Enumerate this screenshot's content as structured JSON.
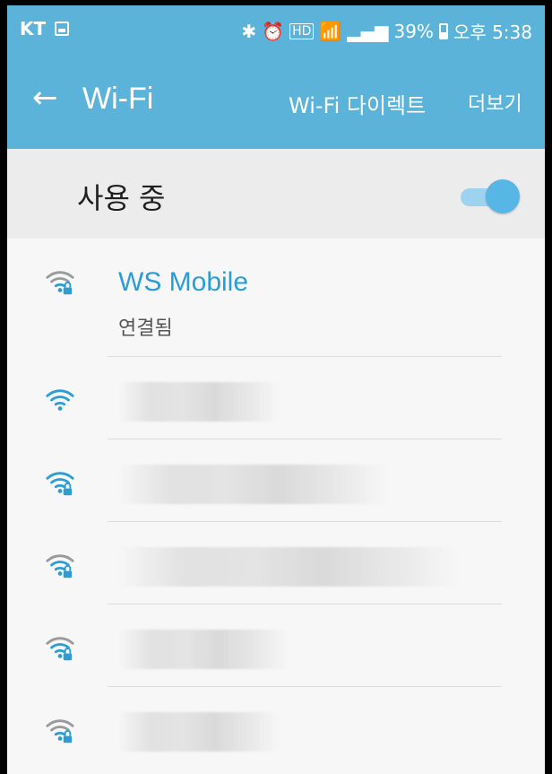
{
  "status": {
    "carrier": "KT",
    "battery_text": "39%",
    "time_text": "오후 5:38",
    "icons": [
      "bluetooth-icon",
      "alarm-icon",
      "hd-icon",
      "wifi-signal-icon",
      "cell-signal-icon",
      "battery-icon"
    ]
  },
  "appbar": {
    "title": "Wi-Fi",
    "actions": [
      {
        "label": "Wi-Fi 다이렉트"
      },
      {
        "label": "더보기"
      }
    ]
  },
  "toggle": {
    "label": "사용 중",
    "state": "on"
  },
  "networks": [
    {
      "ssid": "WS Mobile",
      "status": "연결됨",
      "secured": true
    },
    {
      "ssid": "",
      "status": "",
      "secured": false
    },
    {
      "ssid": "",
      "status": "",
      "secured": true
    },
    {
      "ssid": "",
      "status": "",
      "secured": true
    },
    {
      "ssid": "",
      "status": "",
      "secured": true
    },
    {
      "ssid": "",
      "status": "",
      "secured": true
    }
  ],
  "colors": {
    "accent": "#5bb3da",
    "connected_text": "#2a9ed4",
    "switch_thumb": "#57b6e5",
    "switch_track": "#9ed3ef"
  }
}
